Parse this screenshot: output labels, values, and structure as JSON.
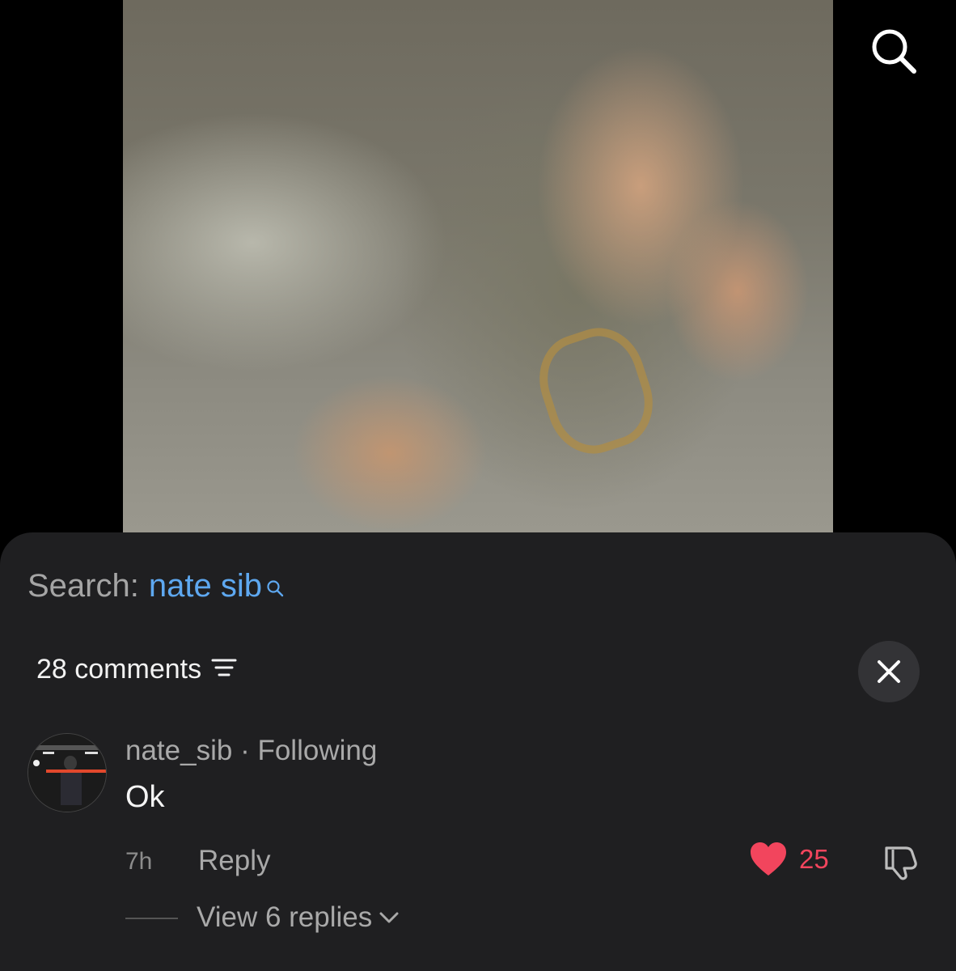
{
  "video": {
    "description_icon": "search-icon"
  },
  "sheet": {
    "search_label": "Search:",
    "search_query": "nate sib",
    "comments_count_label": "28 comments"
  },
  "comment": {
    "author": "nate_sib",
    "separator": "·",
    "relation": "Following",
    "text": "Ok",
    "time": "7h",
    "reply_label": "Reply",
    "likes": "25",
    "view_replies_label": "View 6 replies"
  },
  "colors": {
    "sheet_bg": "#1f1f21",
    "link_blue": "#5ea8f0",
    "like_red": "#f2455d",
    "muted_text": "#a9a9a9"
  }
}
